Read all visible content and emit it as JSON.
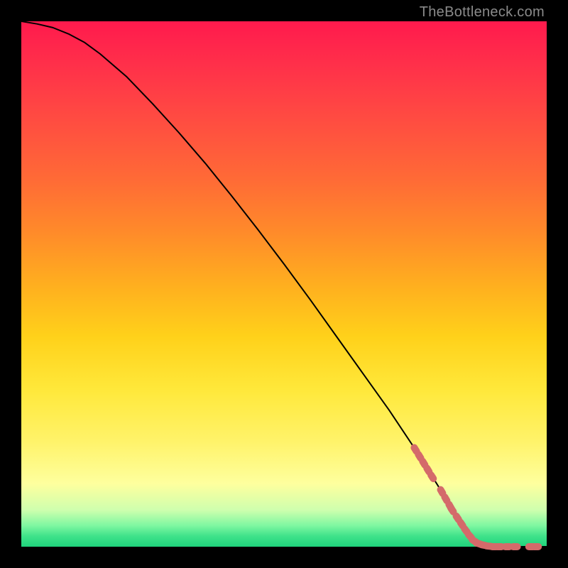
{
  "watermark": "TheBottleneck.com",
  "chart_data": {
    "type": "line",
    "title": "",
    "xlabel": "",
    "ylabel": "",
    "xlim": [
      0,
      100
    ],
    "ylim": [
      0,
      100
    ],
    "grid": false,
    "legend": false,
    "background": "rainbow-gradient-vertical",
    "series": [
      {
        "name": "curve",
        "x": [
          0,
          3,
          6,
          9,
          12,
          15,
          20,
          25,
          30,
          35,
          40,
          45,
          50,
          55,
          60,
          65,
          70,
          75,
          80,
          82,
          84,
          86,
          88,
          90,
          92,
          94,
          96,
          98,
          100
        ],
        "y": [
          100,
          99.5,
          98.8,
          97.6,
          96.0,
          93.8,
          89.5,
          84.3,
          78.8,
          73.0,
          66.8,
          60.4,
          53.8,
          47.0,
          40.0,
          33.0,
          26.0,
          18.5,
          10.5,
          7.0,
          4.0,
          1.5,
          0.3,
          0.0,
          0.0,
          0.0,
          0.0,
          0.0,
          0.0
        ]
      }
    ],
    "markers": {
      "name": "highlighted-points",
      "color": "#d46a6a",
      "points": [
        {
          "x": 75.0,
          "y": 18.5
        },
        {
          "x": 75.8,
          "y": 17.2
        },
        {
          "x": 76.6,
          "y": 15.9
        },
        {
          "x": 77.4,
          "y": 14.6
        },
        {
          "x": 78.2,
          "y": 13.3
        },
        {
          "x": 80.0,
          "y": 10.5
        },
        {
          "x": 80.8,
          "y": 9.1
        },
        {
          "x": 81.6,
          "y": 7.7
        },
        {
          "x": 82.0,
          "y": 7.0
        },
        {
          "x": 83.0,
          "y": 5.5
        },
        {
          "x": 83.8,
          "y": 4.3
        },
        {
          "x": 84.6,
          "y": 3.1
        },
        {
          "x": 85.4,
          "y": 2.0
        },
        {
          "x": 86.2,
          "y": 1.1
        },
        {
          "x": 87.0,
          "y": 0.6
        },
        {
          "x": 88.0,
          "y": 0.3
        },
        {
          "x": 89.0,
          "y": 0.1
        },
        {
          "x": 90.0,
          "y": 0.0
        },
        {
          "x": 91.0,
          "y": 0.0
        },
        {
          "x": 92.5,
          "y": 0.0
        },
        {
          "x": 94.0,
          "y": 0.0
        },
        {
          "x": 97.0,
          "y": 0.0
        },
        {
          "x": 98.0,
          "y": 0.0
        }
      ]
    }
  }
}
